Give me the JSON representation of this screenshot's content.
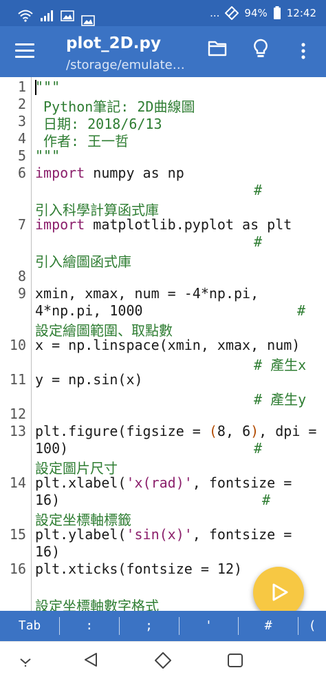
{
  "status_bar": {
    "ellipsis": "...",
    "battery": "94%",
    "time": "12:42"
  },
  "app_bar": {
    "title": "plot_2D.py",
    "path": "/storage/emulate…"
  },
  "code": {
    "l1": "\"\"\"",
    "l2": " Python筆記: 2D曲線圖",
    "l3": " 日期: 2018/6/13",
    "l4": " 作者: 王一哲",
    "l5": "\"\"\"",
    "l6_kw": "import",
    "l6_rest": " numpy as np",
    "l6_hash": "#",
    "l6_c": "引入科學計算函式庫",
    "l7_kw": "import",
    "l7_rest": " matplotlib.pyplot as plt",
    "l7_hash": "#",
    "l7_c": "引入繪圖函式庫",
    "l9_a": "xmin, xmax, num = -4*np.pi,",
    "l9_b": "4*np.pi, 1000",
    "l9_hash": "#",
    "l9_c": "設定繪圖範圍、取點數",
    "l10": "x = np.linspace(xmin, xmax, num)",
    "l10_c": "# 產生x",
    "l11": "y = np.sin(x)",
    "l11_c": "# 產生y",
    "l13_a": "plt.figure(figsize = ",
    "l13_p1": "(",
    "l13_n1": "8",
    "l13_m": ", ",
    "l13_n2": "6",
    "l13_p2": ")",
    "l13_b": ", dpi =",
    "l13_c": "100)",
    "l13_hash": "#",
    "l13_cm": "設定圖片尺寸",
    "l14_a": "plt.xlabel(",
    "l14_s": "'x(rad)'",
    "l14_b": ", fontsize =",
    "l14_c": "16)",
    "l14_hash": "#",
    "l14_cm": "設定坐標軸標籤",
    "l15_a": "plt.ylabel(",
    "l15_s": "'sin(x)'",
    "l15_b": ", fontsize =",
    "l15_c": "16)",
    "l16": "plt.xticks(fontsize = 12)",
    "l16_cm": "設定坐標軸數字格式"
  },
  "symbol_bar": {
    "tab": "Tab",
    "colon": ":",
    "semicolon": ";",
    "quote": "'",
    "hash": "#",
    "paren": "("
  },
  "colors": {
    "app_bar": "#3b73c4",
    "status_bar": "#2f65b5",
    "fab": "#f7c843",
    "comment": "#2e7d32",
    "keyword": "#8b1f6b",
    "number": "#b24a00"
  }
}
